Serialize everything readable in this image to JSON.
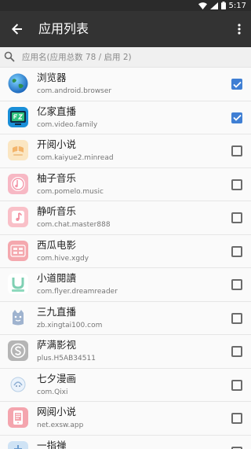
{
  "status_bar": {
    "time": "5:17"
  },
  "toolbar": {
    "title": "应用列表"
  },
  "search": {
    "placeholder": "应用名(应用总数 78 / 启用 2)"
  },
  "apps": [
    {
      "name": "浏览器",
      "package": "com.android.browser",
      "icon": "globe-icon",
      "checked": true
    },
    {
      "name": "亿家直播",
      "package": "com.video.family",
      "icon": "tv-icon",
      "checked": true
    },
    {
      "name": "开阅小说",
      "package": "com.kaiyue2.minread",
      "icon": "book-logo-icon",
      "checked": false
    },
    {
      "name": "柚子音乐",
      "package": "com.pomelo.music",
      "icon": "music-disc-icon",
      "checked": false
    },
    {
      "name": "静听音乐",
      "package": "com.chat.master888",
      "icon": "music-note-icon",
      "checked": false
    },
    {
      "name": "西瓜电影",
      "package": "com.hive.xgdy",
      "icon": "movie-badge-icon",
      "checked": false
    },
    {
      "name": "小道閱讀",
      "package": "com.flyer.dreamreader",
      "icon": "reader-u-icon",
      "checked": false
    },
    {
      "name": "三九直播",
      "package": "zb.xingtai100.com",
      "icon": "mascot-icon",
      "checked": false
    },
    {
      "name": "萨满影视",
      "package": "plus.H5AB34511",
      "icon": "s-logo-icon",
      "checked": false
    },
    {
      "name": "七夕漫画",
      "package": "com.Qixi",
      "icon": "comic-icon",
      "checked": false
    },
    {
      "name": "网阅小说",
      "package": "net.exsw.app",
      "icon": "phone-book-icon",
      "checked": false
    },
    {
      "name": "一指禅",
      "package": "",
      "icon": "app-icon",
      "checked": false
    }
  ],
  "colors": {
    "toolbar": "#333333",
    "statusbar": "#2b2b2b",
    "checkbox_checked": "#3f7fd4"
  }
}
